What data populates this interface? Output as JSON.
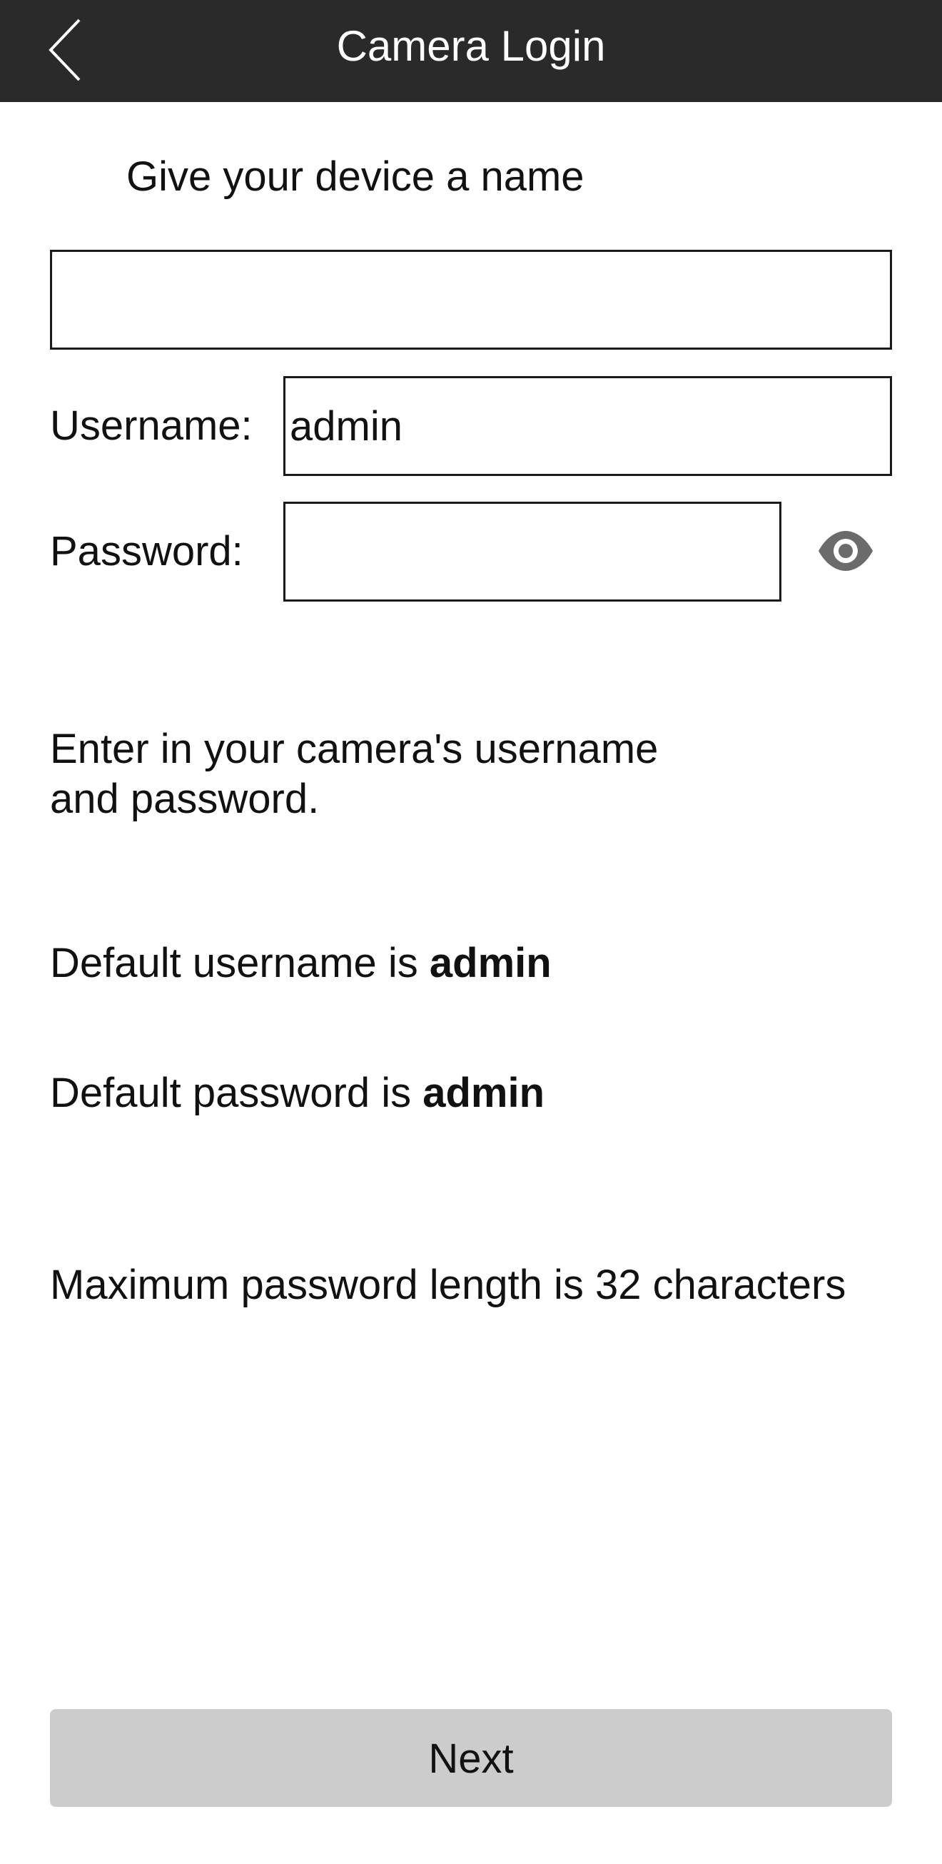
{
  "header": {
    "title": "Camera Login",
    "back_icon": "chevron-left-icon"
  },
  "device_name": {
    "prompt": "Give your device a name",
    "value": "",
    "placeholder": ""
  },
  "username": {
    "label": "Username:",
    "value": "admin"
  },
  "password": {
    "label": "Password:",
    "value": "",
    "toggle_icon": "eye-icon"
  },
  "info": {
    "instructions": "Enter in your camera's username and password.",
    "default_user_prefix": "Default username is ",
    "default_user_value": "admin",
    "default_pass_prefix": "Default password is ",
    "default_pass_value": "admin",
    "max_length": "Maximum password length is 32 characters"
  },
  "actions": {
    "next_label": "Next"
  },
  "colors": {
    "header_bg": "#2a2a2a",
    "button_bg": "#cccccc",
    "icon_gray": "#6b6b6b"
  }
}
